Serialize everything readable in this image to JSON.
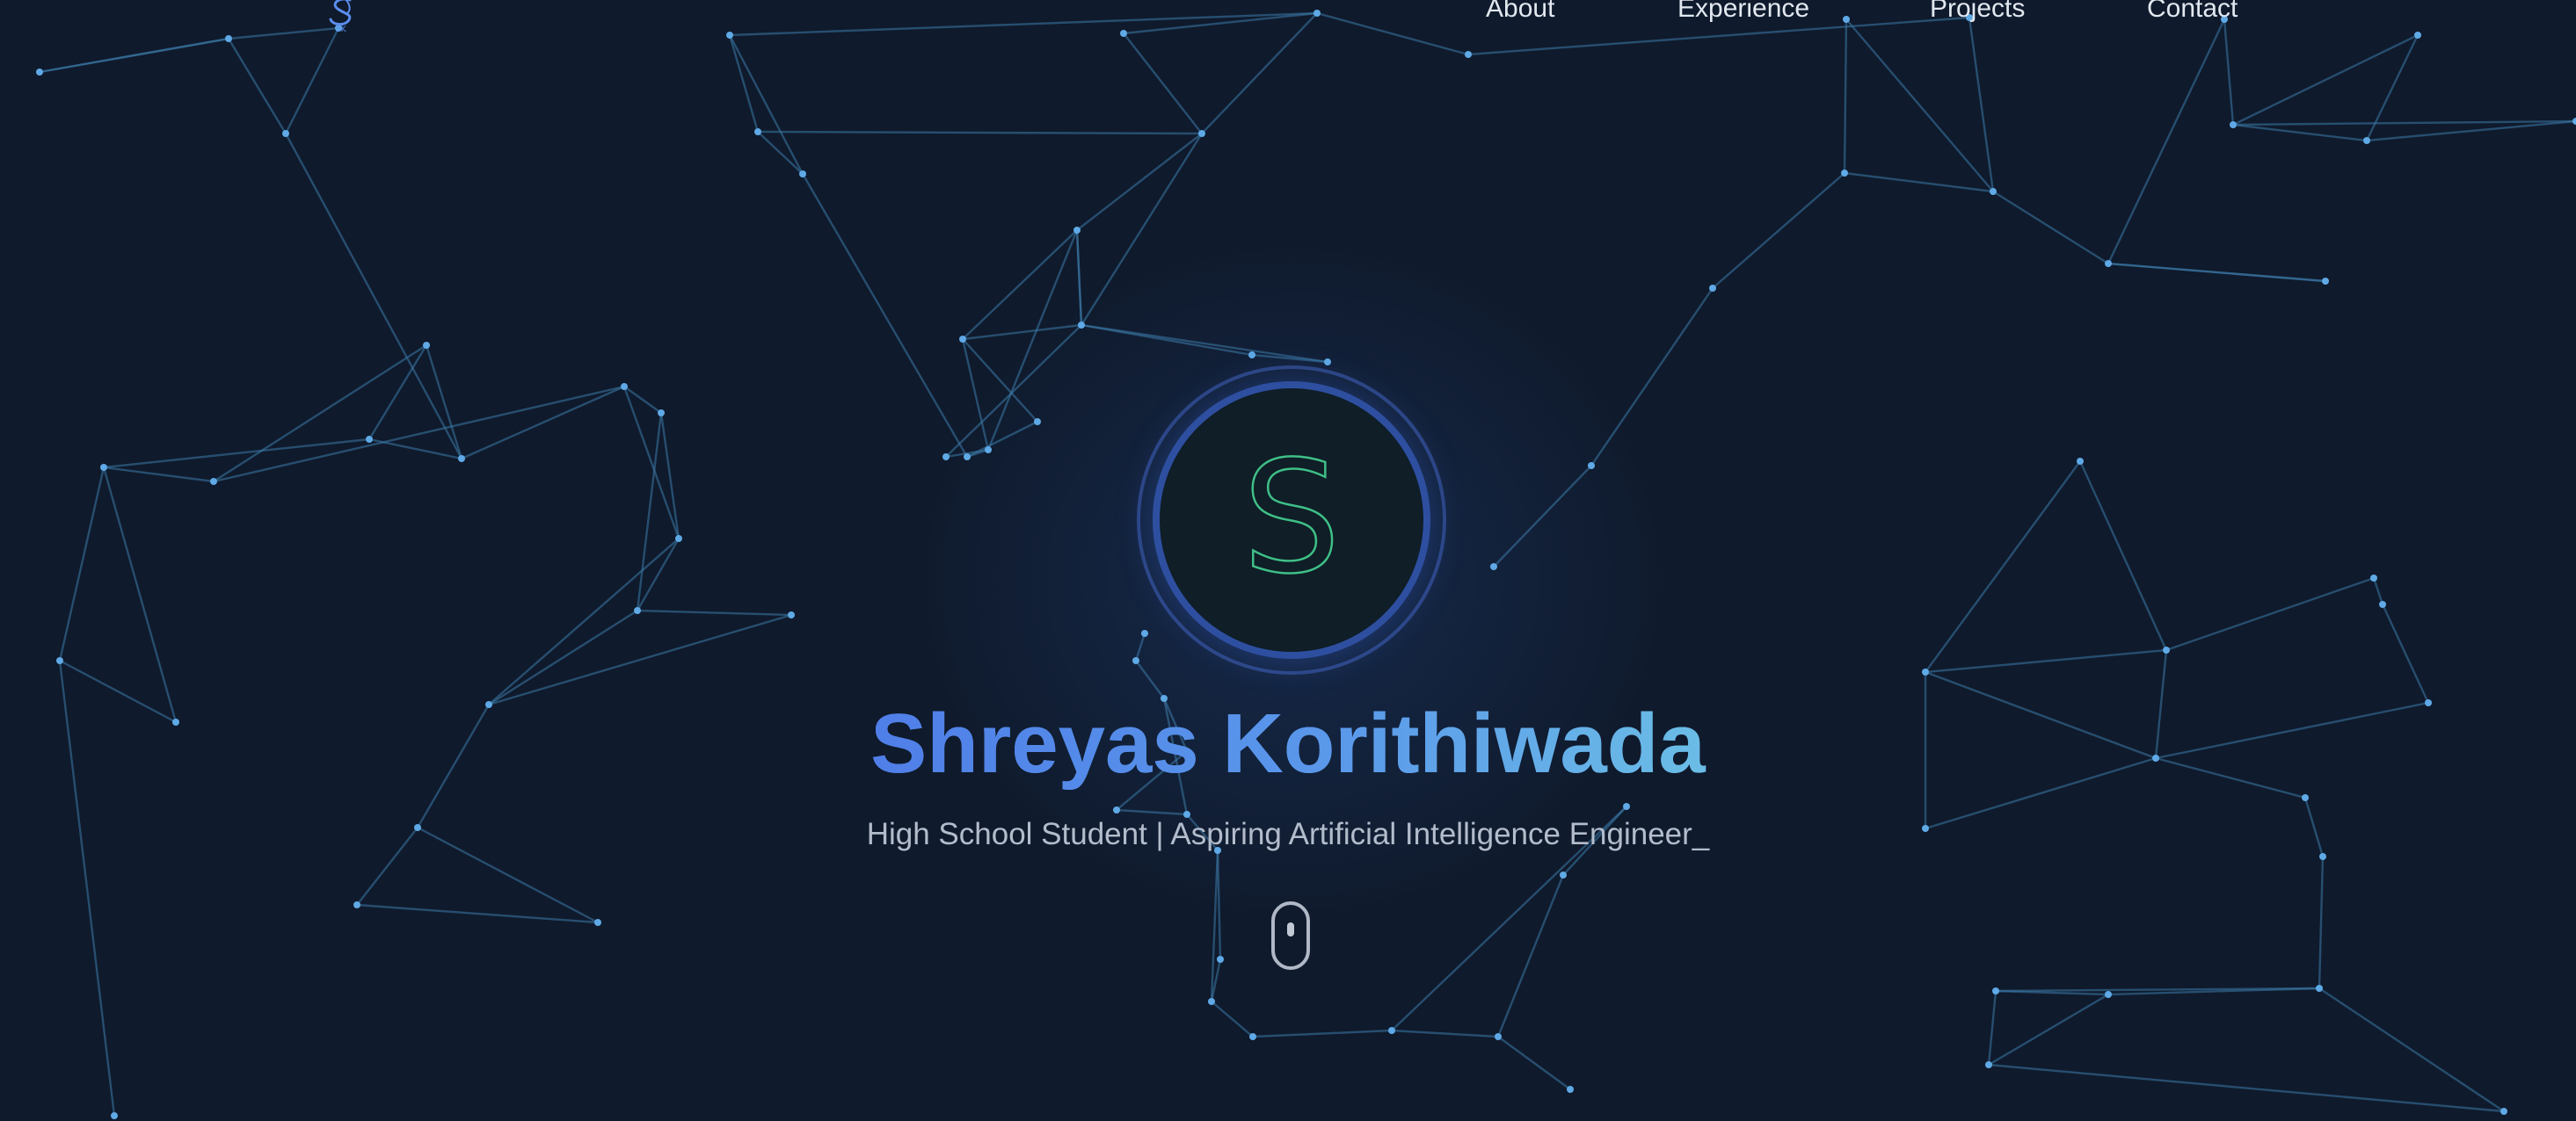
{
  "logo": {
    "label": "SK"
  },
  "nav": {
    "items": [
      {
        "label": "About"
      },
      {
        "label": "Experience"
      },
      {
        "label": "Projects"
      },
      {
        "label": "Contact"
      }
    ]
  },
  "hero": {
    "avatar_letter": "S",
    "name": "Shreyas Korithiwada",
    "tagline": "High School Student | Aspiring Artificial Intelligence Engineer_"
  },
  "colors": {
    "background": "#0f1a2c",
    "accent_blue": "#4f82ea",
    "accent_green": "#3fbf87",
    "network_line": "#3d7aa8"
  },
  "icons": {
    "scroll": "mouse-scroll-icon",
    "logo": "sk-logo-icon"
  }
}
